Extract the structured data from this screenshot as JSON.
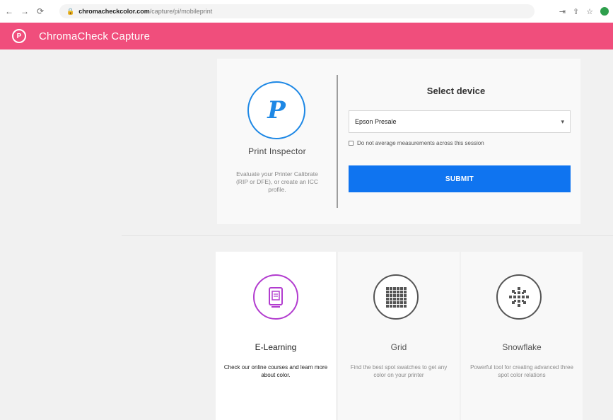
{
  "browser": {
    "back": "←",
    "forward": "→",
    "reload": "⟳",
    "url_host": "chromacheckcolor.com",
    "url_path": "/capture/pi/mobileprint",
    "icons": [
      "share-icon",
      "bookmark-icon",
      "star-icon",
      "profile-icon"
    ]
  },
  "header": {
    "title": "ChromaCheck Capture",
    "logo_letter": "P",
    "brand_color": "#f04e7c"
  },
  "print_inspector": {
    "logo_letter": "P",
    "title": "Print Inspector",
    "description": "Evaluate your Printer Calibrate (RIP or DFE), or create an ICC profile.",
    "accent_color": "#1e88e5"
  },
  "device_form": {
    "title": "Select device",
    "selected_device": "Epson Presale",
    "checkbox_label": "Do not average measurements across this session",
    "checkbox_checked": false,
    "submit_label": "SUBMIT",
    "submit_color": "#0f74f0"
  },
  "cards": [
    {
      "title": "E-Learning",
      "description": "Check our online courses and learn more about color.",
      "icon": "book-icon",
      "accent_color": "#b23ccf",
      "active": true
    },
    {
      "title": "Grid",
      "description": "Find the best spot swatches to get any color on your printer",
      "icon": "grid-icon",
      "accent_color": "#555555",
      "active": false
    },
    {
      "title": "Snowflake",
      "description": "Powerful tool for creating advanced three spot color relations",
      "icon": "snowflake-icon",
      "accent_color": "#555555",
      "active": false
    }
  ]
}
